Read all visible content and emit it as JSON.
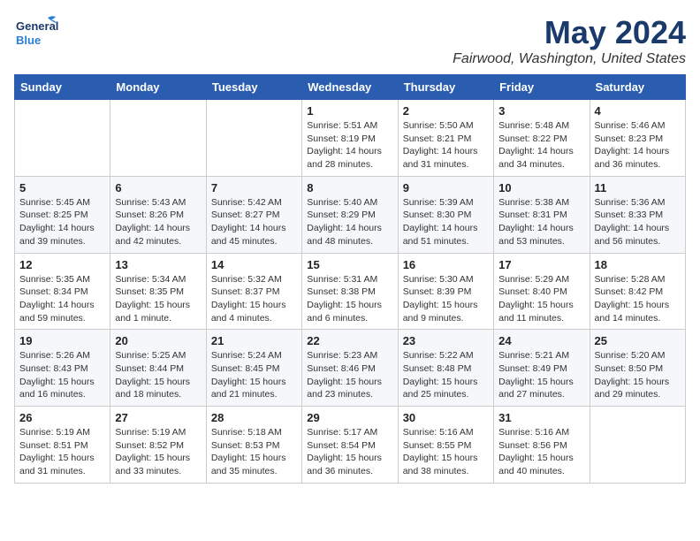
{
  "header": {
    "logo_general": "General",
    "logo_blue": "Blue",
    "title": "May 2024",
    "subtitle": "Fairwood, Washington, United States"
  },
  "weekdays": [
    "Sunday",
    "Monday",
    "Tuesday",
    "Wednesday",
    "Thursday",
    "Friday",
    "Saturday"
  ],
  "weeks": [
    [
      {
        "day": "",
        "info": ""
      },
      {
        "day": "",
        "info": ""
      },
      {
        "day": "",
        "info": ""
      },
      {
        "day": "1",
        "info": "Sunrise: 5:51 AM\nSunset: 8:19 PM\nDaylight: 14 hours\nand 28 minutes."
      },
      {
        "day": "2",
        "info": "Sunrise: 5:50 AM\nSunset: 8:21 PM\nDaylight: 14 hours\nand 31 minutes."
      },
      {
        "day": "3",
        "info": "Sunrise: 5:48 AM\nSunset: 8:22 PM\nDaylight: 14 hours\nand 34 minutes."
      },
      {
        "day": "4",
        "info": "Sunrise: 5:46 AM\nSunset: 8:23 PM\nDaylight: 14 hours\nand 36 minutes."
      }
    ],
    [
      {
        "day": "5",
        "info": "Sunrise: 5:45 AM\nSunset: 8:25 PM\nDaylight: 14 hours\nand 39 minutes."
      },
      {
        "day": "6",
        "info": "Sunrise: 5:43 AM\nSunset: 8:26 PM\nDaylight: 14 hours\nand 42 minutes."
      },
      {
        "day": "7",
        "info": "Sunrise: 5:42 AM\nSunset: 8:27 PM\nDaylight: 14 hours\nand 45 minutes."
      },
      {
        "day": "8",
        "info": "Sunrise: 5:40 AM\nSunset: 8:29 PM\nDaylight: 14 hours\nand 48 minutes."
      },
      {
        "day": "9",
        "info": "Sunrise: 5:39 AM\nSunset: 8:30 PM\nDaylight: 14 hours\nand 51 minutes."
      },
      {
        "day": "10",
        "info": "Sunrise: 5:38 AM\nSunset: 8:31 PM\nDaylight: 14 hours\nand 53 minutes."
      },
      {
        "day": "11",
        "info": "Sunrise: 5:36 AM\nSunset: 8:33 PM\nDaylight: 14 hours\nand 56 minutes."
      }
    ],
    [
      {
        "day": "12",
        "info": "Sunrise: 5:35 AM\nSunset: 8:34 PM\nDaylight: 14 hours\nand 59 minutes."
      },
      {
        "day": "13",
        "info": "Sunrise: 5:34 AM\nSunset: 8:35 PM\nDaylight: 15 hours\nand 1 minute."
      },
      {
        "day": "14",
        "info": "Sunrise: 5:32 AM\nSunset: 8:37 PM\nDaylight: 15 hours\nand 4 minutes."
      },
      {
        "day": "15",
        "info": "Sunrise: 5:31 AM\nSunset: 8:38 PM\nDaylight: 15 hours\nand 6 minutes."
      },
      {
        "day": "16",
        "info": "Sunrise: 5:30 AM\nSunset: 8:39 PM\nDaylight: 15 hours\nand 9 minutes."
      },
      {
        "day": "17",
        "info": "Sunrise: 5:29 AM\nSunset: 8:40 PM\nDaylight: 15 hours\nand 11 minutes."
      },
      {
        "day": "18",
        "info": "Sunrise: 5:28 AM\nSunset: 8:42 PM\nDaylight: 15 hours\nand 14 minutes."
      }
    ],
    [
      {
        "day": "19",
        "info": "Sunrise: 5:26 AM\nSunset: 8:43 PM\nDaylight: 15 hours\nand 16 minutes."
      },
      {
        "day": "20",
        "info": "Sunrise: 5:25 AM\nSunset: 8:44 PM\nDaylight: 15 hours\nand 18 minutes."
      },
      {
        "day": "21",
        "info": "Sunrise: 5:24 AM\nSunset: 8:45 PM\nDaylight: 15 hours\nand 21 minutes."
      },
      {
        "day": "22",
        "info": "Sunrise: 5:23 AM\nSunset: 8:46 PM\nDaylight: 15 hours\nand 23 minutes."
      },
      {
        "day": "23",
        "info": "Sunrise: 5:22 AM\nSunset: 8:48 PM\nDaylight: 15 hours\nand 25 minutes."
      },
      {
        "day": "24",
        "info": "Sunrise: 5:21 AM\nSunset: 8:49 PM\nDaylight: 15 hours\nand 27 minutes."
      },
      {
        "day": "25",
        "info": "Sunrise: 5:20 AM\nSunset: 8:50 PM\nDaylight: 15 hours\nand 29 minutes."
      }
    ],
    [
      {
        "day": "26",
        "info": "Sunrise: 5:19 AM\nSunset: 8:51 PM\nDaylight: 15 hours\nand 31 minutes."
      },
      {
        "day": "27",
        "info": "Sunrise: 5:19 AM\nSunset: 8:52 PM\nDaylight: 15 hours\nand 33 minutes."
      },
      {
        "day": "28",
        "info": "Sunrise: 5:18 AM\nSunset: 8:53 PM\nDaylight: 15 hours\nand 35 minutes."
      },
      {
        "day": "29",
        "info": "Sunrise: 5:17 AM\nSunset: 8:54 PM\nDaylight: 15 hours\nand 36 minutes."
      },
      {
        "day": "30",
        "info": "Sunrise: 5:16 AM\nSunset: 8:55 PM\nDaylight: 15 hours\nand 38 minutes."
      },
      {
        "day": "31",
        "info": "Sunrise: 5:16 AM\nSunset: 8:56 PM\nDaylight: 15 hours\nand 40 minutes."
      },
      {
        "day": "",
        "info": ""
      }
    ]
  ]
}
